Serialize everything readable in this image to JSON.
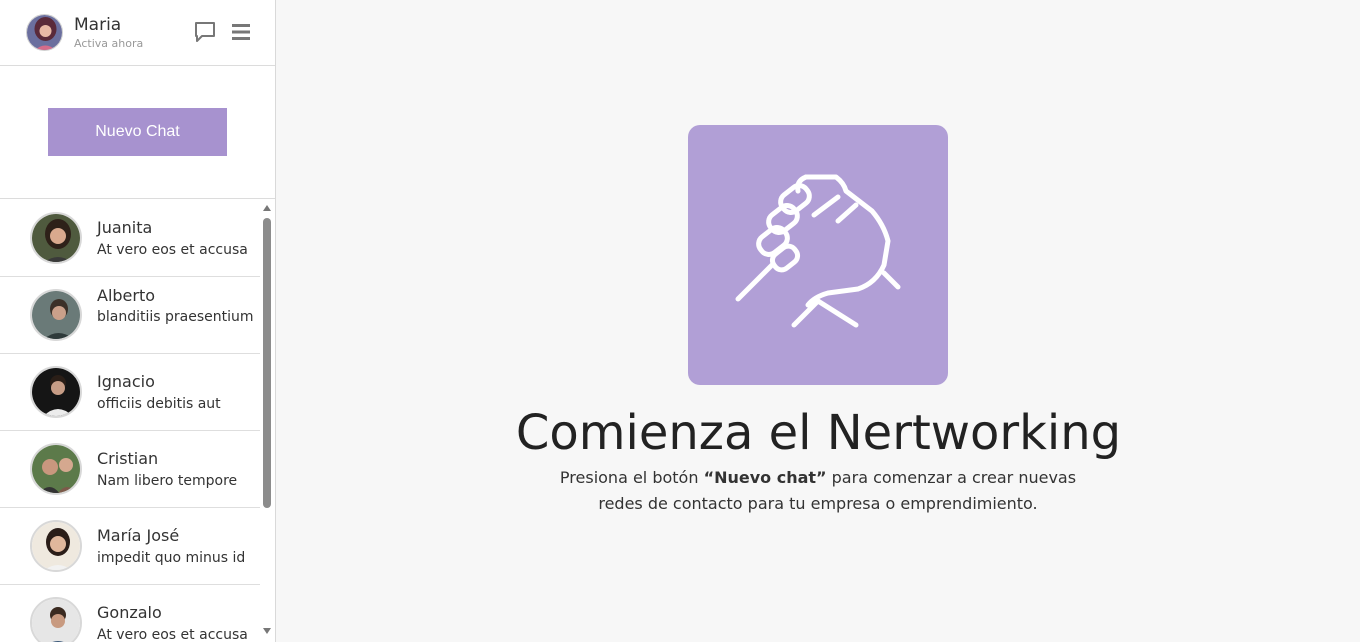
{
  "profile": {
    "name": "Maria",
    "status": "Activa ahora",
    "avatar_icon": "user-avatar",
    "chat_icon": "chat-bubble-icon",
    "menu_icon": "hamburger-menu-icon"
  },
  "new_chat": {
    "label": "Nuevo Chat"
  },
  "chats": [
    {
      "name": "Juanita",
      "message": "At vero eos et accusa"
    },
    {
      "name": "Alberto",
      "message": "blanditiis praesentium"
    },
    {
      "name": "Ignacio",
      "message": "officiis debitis aut"
    },
    {
      "name": "Cristian",
      "message": "Nam libero tempore"
    },
    {
      "name": "María José",
      "message": "impedit quo minus id"
    },
    {
      "name": "Gonzalo",
      "message": "At vero eos et accusa"
    }
  ],
  "main": {
    "hero_icon": "handshake-icon",
    "title": "Comienza el Nertworking",
    "desc_before": "Presiona el botón ",
    "desc_bold": "“Nuevo chat”",
    "desc_after": " para comenzar a crear nuevas redes de contacto para tu empresa o emprendimiento."
  },
  "colors": {
    "accent": "#a792cf",
    "hero_bg": "#b19fd6",
    "page_bg": "#f7f7f7"
  }
}
